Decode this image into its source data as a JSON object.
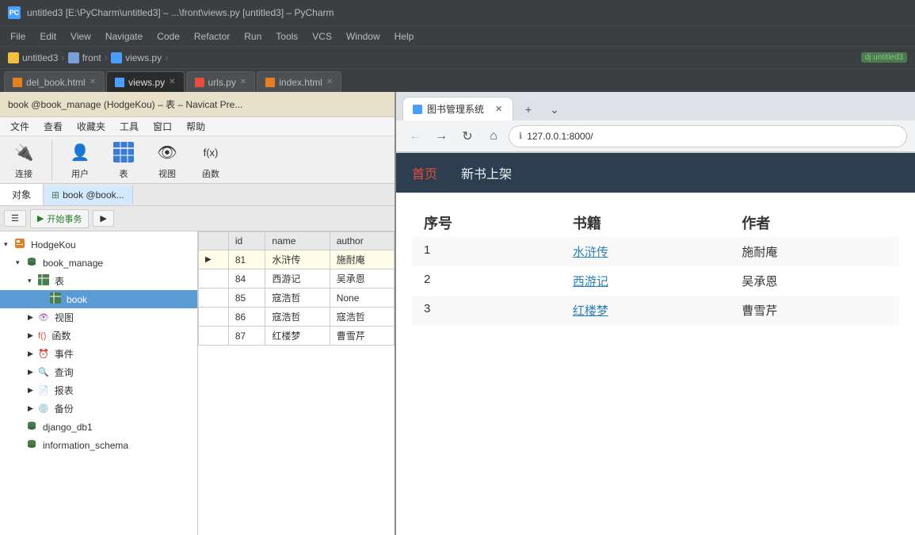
{
  "titleBar": {
    "icon": "PC",
    "title": "untitled3 [E:\\PyCharm\\untitled3] – ...\\front\\views.py [untitled3] – PyCharm"
  },
  "menuBar": {
    "items": [
      "File",
      "Edit",
      "View",
      "Navigate",
      "Code",
      "Refactor",
      "Run",
      "Tools",
      "VCS",
      "Window",
      "Help"
    ]
  },
  "breadcrumb": {
    "project": "untitled3",
    "folder": "front",
    "file": "views.py",
    "badge": "dj untitled3"
  },
  "tabs": [
    {
      "label": "del_book.html",
      "type": "html",
      "active": false
    },
    {
      "label": "views.py",
      "type": "py",
      "active": true
    },
    {
      "label": "urls.py",
      "type": "urls",
      "active": false
    },
    {
      "label": "index.html",
      "type": "html",
      "active": false
    }
  ],
  "navicat": {
    "title": "book @book_manage (HodgeKou) – 表 – Navicat Pre...",
    "menu": [
      "文件",
      "查看",
      "收藏夹",
      "工具",
      "窗口",
      "帮助"
    ],
    "toolbar": [
      {
        "label": "连接",
        "icon": "🔌"
      },
      {
        "label": "用户",
        "icon": "👤"
      },
      {
        "label": "表",
        "icon": "⊞"
      },
      {
        "label": "视图",
        "icon": "👁"
      },
      {
        "label": "函数",
        "icon": "f(x)"
      }
    ],
    "objectTabs": [
      "对象",
      "book @book..."
    ],
    "actionBar": {
      "menu": "☰",
      "start": "开始事务",
      "other": "▶"
    },
    "tree": {
      "items": [
        {
          "level": 0,
          "label": "HodgeKou",
          "arrow": "▾",
          "icon": "connection",
          "expanded": true
        },
        {
          "level": 1,
          "label": "book_manage",
          "arrow": "▾",
          "icon": "db",
          "expanded": true
        },
        {
          "level": 2,
          "label": "表",
          "arrow": "▾",
          "icon": "table",
          "expanded": true
        },
        {
          "level": 3,
          "label": "book",
          "arrow": "",
          "icon": "table",
          "selected": true,
          "highlighted": true
        },
        {
          "level": 2,
          "label": "视图",
          "arrow": "▶",
          "icon": "view",
          "expanded": false
        },
        {
          "level": 2,
          "label": "函数",
          "arrow": "▶",
          "icon": "func",
          "expanded": false
        },
        {
          "level": 2,
          "label": "事件",
          "arrow": "▶",
          "icon": "event",
          "expanded": false
        },
        {
          "level": 2,
          "label": "查询",
          "arrow": "▶",
          "icon": "query",
          "expanded": false
        },
        {
          "level": 2,
          "label": "报表",
          "arrow": "▶",
          "icon": "report",
          "expanded": false
        },
        {
          "level": 2,
          "label": "备份",
          "arrow": "▶",
          "icon": "backup",
          "expanded": false
        },
        {
          "level": 1,
          "label": "django_db1",
          "arrow": "",
          "icon": "db",
          "expanded": false
        },
        {
          "level": 1,
          "label": "information_schema",
          "arrow": "",
          "icon": "db",
          "expanded": false
        }
      ]
    },
    "table": {
      "headers": [
        "id",
        "name",
        "author"
      ],
      "rows": [
        {
          "id": "81",
          "name": "水浒传",
          "author": "施耐庵",
          "current": true
        },
        {
          "id": "84",
          "name": "西游记",
          "author": "吴承恩"
        },
        {
          "id": "85",
          "name": "寇浩哲",
          "author": "None"
        },
        {
          "id": "86",
          "name": "寇浩哲",
          "author": "寇浩哲"
        },
        {
          "id": "87",
          "name": "红楼梦",
          "author": "曹雪芹"
        }
      ]
    }
  },
  "browser": {
    "tabLabel": "图书管理系统",
    "url": "127.0.0.1:8000/",
    "nav": [
      {
        "label": "首页",
        "active": true
      },
      {
        "label": "新书上架",
        "active": false
      }
    ],
    "table": {
      "headers": [
        "序号",
        "书籍",
        "作者"
      ],
      "rows": [
        {
          "num": "1",
          "book": "水浒传",
          "author": "施耐庵"
        },
        {
          "num": "2",
          "book": "西游记",
          "author": "吴承恩"
        },
        {
          "num": "3",
          "book": "红楼梦",
          "author": "曹雪芹"
        }
      ]
    }
  }
}
